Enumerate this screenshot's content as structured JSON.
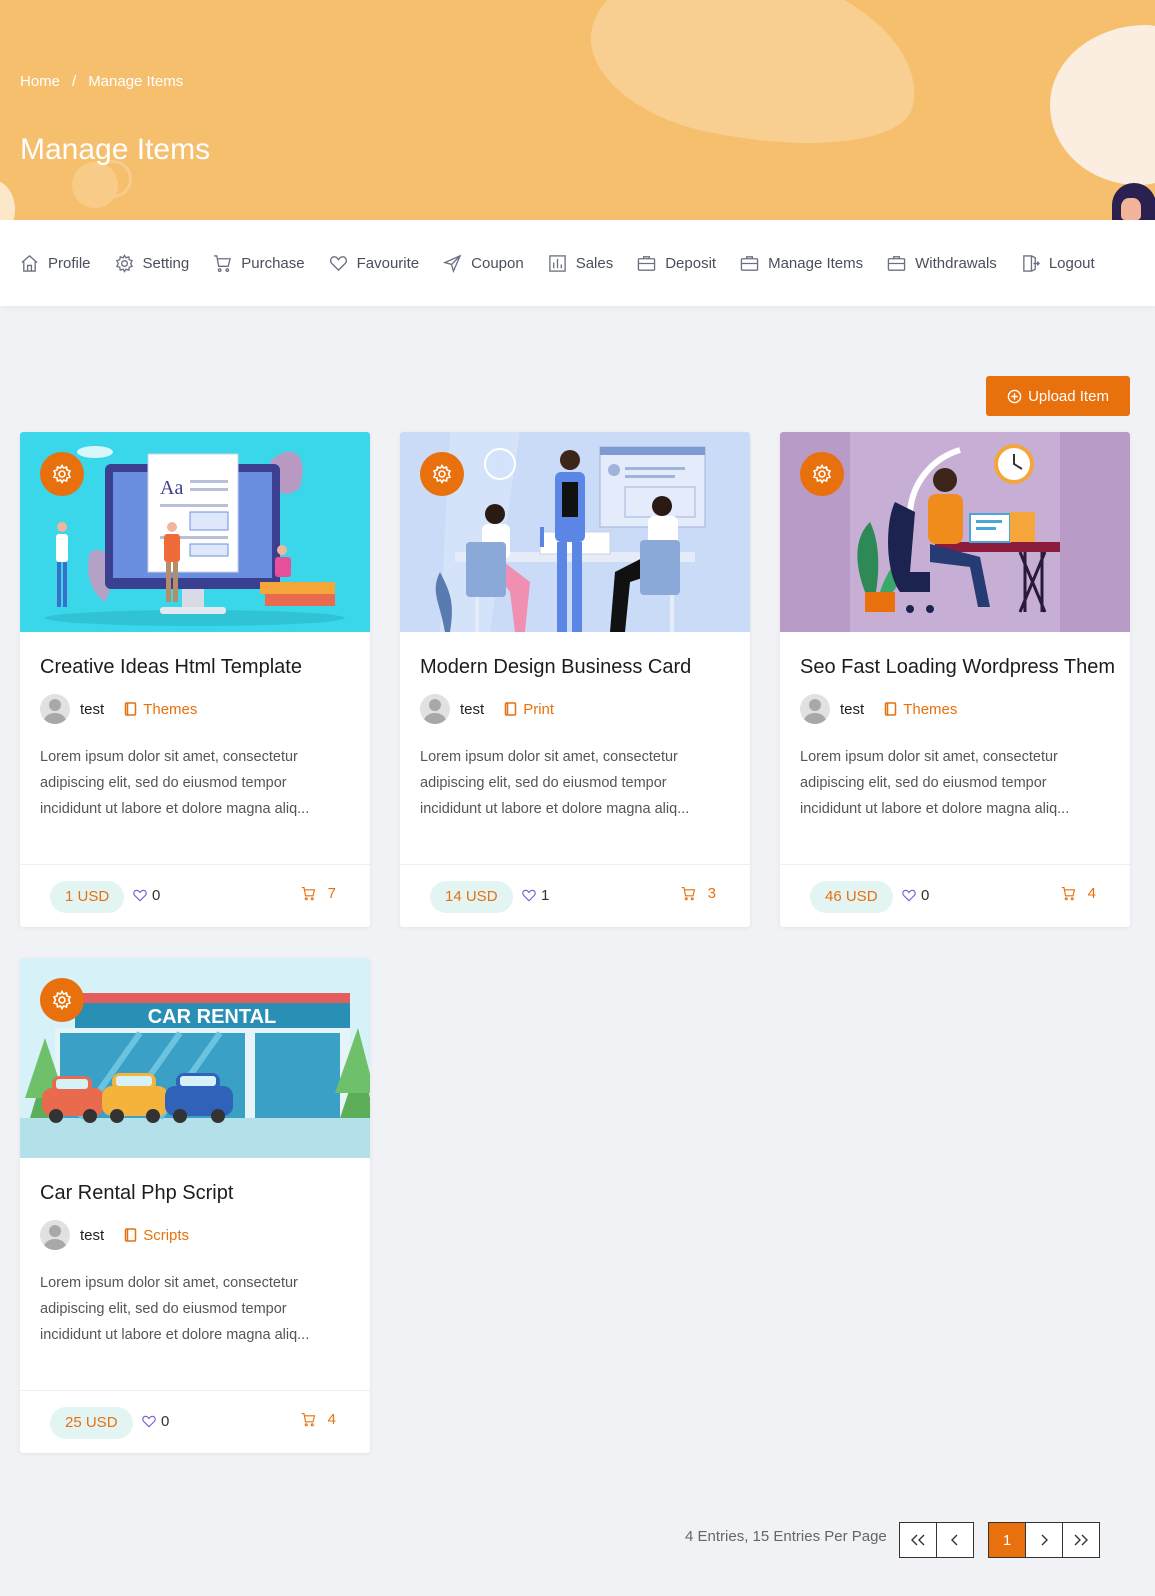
{
  "breadcrumb": {
    "home": "Home",
    "separator": "/",
    "current": "Manage Items"
  },
  "page_title": "Manage Items",
  "nav": [
    {
      "label": "Profile",
      "icon": "home-icon"
    },
    {
      "label": "Setting",
      "icon": "gear-icon"
    },
    {
      "label": "Purchase",
      "icon": "cart-icon"
    },
    {
      "label": "Favourite",
      "icon": "heart-icon"
    },
    {
      "label": "Coupon",
      "icon": "send-icon"
    },
    {
      "label": "Sales",
      "icon": "chart-icon"
    },
    {
      "label": "Deposit",
      "icon": "briefcase-icon"
    },
    {
      "label": "Manage Items",
      "icon": "briefcase-icon"
    },
    {
      "label": "Withdrawals",
      "icon": "briefcase-icon"
    },
    {
      "label": "Logout",
      "icon": "logout-icon"
    }
  ],
  "upload_button": "Upload Item",
  "items": [
    {
      "title": "Creative Ideas Html Template",
      "author": "test",
      "category": "Themes",
      "description": "Lorem ipsum dolor sit amet, consectetur adipiscing elit, sed do eiusmod tempor incididunt ut labore et dolore magna aliq...",
      "price": "1 USD",
      "likes": "0",
      "sales": "7"
    },
    {
      "title": "Modern Design Business Card",
      "author": "test",
      "category": "Print",
      "description": "Lorem ipsum dolor sit amet, consectetur adipiscing elit, sed do eiusmod tempor incididunt ut labore et dolore magna aliq...",
      "price": "14 USD",
      "likes": "1",
      "sales": "3"
    },
    {
      "title": "Seo Fast Loading Wordpress Them",
      "author": "test",
      "category": "Themes",
      "description": "Lorem ipsum dolor sit amet, consectetur adipiscing elit, sed do eiusmod tempor incididunt ut labore et dolore magna aliq...",
      "price": "46 USD",
      "likes": "0",
      "sales": "4"
    },
    {
      "title": "Car Rental Php Script",
      "author": "test",
      "category": "Scripts",
      "description": "Lorem ipsum dolor sit amet, consectetur adipiscing elit, sed do eiusmod tempor incididunt ut labore et dolore magna aliq...",
      "price": "25 USD",
      "likes": "0",
      "sales": "4",
      "image_text": "CAR RENTAL"
    }
  ],
  "pagination": {
    "entries_text": "4 Entries, 15 Entries Per Page",
    "current_page": "1"
  },
  "colors": {
    "accent": "#e8700d",
    "banner": "#f6bf6e",
    "price_bg": "#e3f5f3",
    "like": "#7b58d6"
  }
}
